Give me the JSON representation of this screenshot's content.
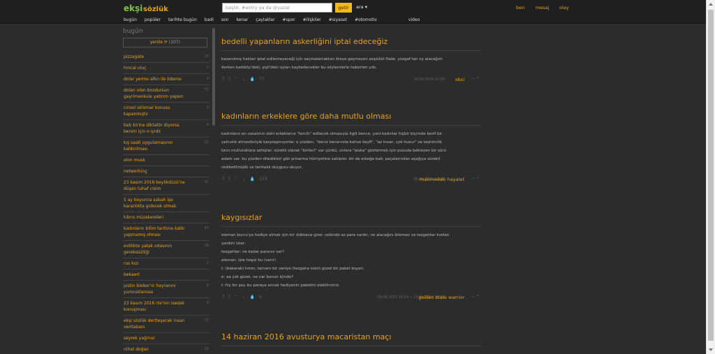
{
  "header": {
    "logo_text": "ekşi sözlük",
    "search_placeholder": "başlık, #entry ya da @yazar",
    "search_button": "getir",
    "search_menu": "ara ▾",
    "links": [
      "ben",
      "mesaj",
      "olay"
    ],
    "nav": [
      "bugün",
      "popüler",
      "tarihte bugün",
      "badi",
      "son",
      "kenar",
      "çaylaklar",
      "#spor",
      "#ilişkiler",
      "#siyaset",
      "#otomotiv",
      "video"
    ]
  },
  "sidebar": {
    "title": "bugün",
    "refresh_label": "yenile ⟳",
    "refresh_count": "(107)",
    "topics": [
      {
        "title": "pizzagate",
        "count": "15"
      },
      {
        "title": "hıncal uluç",
        "count": "2"
      },
      {
        "title": "dolar yerine altın ile ödeme",
        "count": "4"
      },
      {
        "title": "doları olan bozdursun gayrimenkule yatırım yapsın",
        "count": "71"
      },
      {
        "title": "cinsel istismar konusu kapanmıştır",
        "count": "2"
      },
      {
        "title": "batı birine diktatör diyorsa benim için o iyidir",
        "count": "4"
      },
      {
        "title": "kış saati uygulamasının kaldırılması",
        "count": "11"
      },
      {
        "title": "elon musk",
        "count": ""
      },
      {
        "title": "networking",
        "count": ""
      },
      {
        "title": "23 kasım 2016 beylikdüzü'ne düşen tuhaf cisim",
        "count": "31"
      },
      {
        "title": "5 ay boyunca sabah işe karanlıkta gidecek olmak",
        "count": ""
      },
      {
        "title": "kıbrıs müzakereleri",
        "count": ""
      },
      {
        "title": "kadınların bilim tarihine katkı yapmamış olması",
        "count": "47"
      },
      {
        "title": "evlilikte yatak odasının gerekssizliği",
        "count": "18"
      },
      {
        "title": "rus kızı",
        "count": "2"
      },
      {
        "title": "bekaert",
        "count": ""
      },
      {
        "title": "justin bieber'ın hayranını yumruklaması",
        "count": "8"
      },
      {
        "title": "23 kasım 2016 rte'nin isedak konuşması",
        "count": "4"
      },
      {
        "title": "ekşi sözlük dertleşecek insan veritabanı",
        "count": "12"
      },
      {
        "title": "seyrek yağmur",
        "count": ""
      },
      {
        "title": "nihat doğan",
        "count": "10"
      }
    ]
  },
  "entries": [
    {
      "title": "bedelli yapanların askerliğini iptal edeceğiz",
      "lines": [
        "kazanılmış hakları iptal edilemeyeceği için saçmalamaktan öteye geçmeyen popülist ifade. yozgat'tan oy alacağım",
        "derken kadıköy'deki, şişli'deki oyları kaybedecekler bu söylemlerle haberleri yok."
      ],
      "favs": "77",
      "date": "16.08.2015 11:00",
      "author": "obsi"
    },
    {
      "title": "kadınların erkeklere göre daha mutlu olması",
      "lines": [
        "kadınların en vasatının dahi erkeklerce \"tercih\" edilecek olmasıyla ilgili bence. yani kadınlar hiçbir biçimde kesif bir",
        "yalnızlık atmosferiyle karşılaşmıyorlar. o yüzden, \"deniz kenarında kahve keyfi\", \"az insan, çok huzur\" ve teşhircilik",
        "tarzı mutluluklara sahipler. sürekli olarak \"birileri\" var çünkü, onlara \"alaka\" göstermek için pusuda bekleyen bir sürü",
        "adam var. bu yüzden dilediklerl gibi şımarma hürriyetine sahipler. bir de erkeğe bak; paçalarından aşağıya sürekli",
        "reddedilmişlik ve tenhalık duygusu akıyor."
      ],
      "favs": "113",
      "date": "09.04.2016 11:22",
      "author": "makinedeki hayalet"
    },
    {
      "title": "kaygısızlar",
      "lines": [
        "eleman burcu'ya hediye almak için bir dükkana girer. cebinde az para vardır, ne alacağını bilemez ve tezgahtar kızdan",
        "yardım ister:",
        "tezgahtar: ne kadar paranız var?",
        "eleman: işte hepsi bu (verir)",
        "t: (bakarak) hmm, tamam bir saniye (tezgaha süslü güzel bir paket koyar)",
        "e: aa çok güzel, ne var bunun içinde?",
        "t: hiç bir şey. bu paraya ancak hediyenin paketini alabilirsiniz."
      ],
      "favs": "5",
      "date": "09.06.2013 16:24 ~ 15.06.2016 00:07",
      "author": "golden state warrior"
    },
    {
      "title": "14 haziran 2016 avusturya macaristan maçı",
      "lines": [],
      "favs": "",
      "date": "",
      "author": ""
    }
  ]
}
